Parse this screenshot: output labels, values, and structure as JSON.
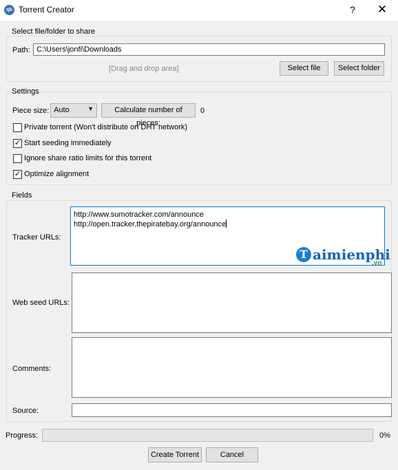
{
  "window": {
    "title": "Torrent Creator",
    "help_label": "?",
    "close_label": "✕"
  },
  "share": {
    "group_title": "Select file/folder to share",
    "path_label": "Path:",
    "path_value": "C:\\Users\\jonfi\\Downloads",
    "drag_drop": "[Drag and drop area]",
    "select_file": "Select file",
    "select_folder": "Select folder"
  },
  "settings": {
    "group_title": "Settings",
    "piece_size_label": "Piece size:",
    "piece_size_value": "Auto",
    "calc_button": "Calculate number of pieces:",
    "pieces_count": "0",
    "options": [
      {
        "label": "Private torrent (Won't distribute on DHT network)",
        "checked": false
      },
      {
        "label": "Start seeding immediately",
        "checked": true
      },
      {
        "label": "Ignore share ratio limits for this torrent",
        "checked": false
      },
      {
        "label": "Optimize alignment",
        "checked": true
      }
    ]
  },
  "fields": {
    "group_title": "Fields",
    "tracker_label": "Tracker URLs:",
    "tracker_lines": [
      "http://www.sumotracker.com/announce",
      "http://open.tracker.thepiratebay.org/announce"
    ],
    "webseed_label": "Web seed URLs:",
    "comments_label": "Comments:",
    "source_label": "Source:",
    "source_value": ""
  },
  "progress": {
    "label": "Progress:",
    "value": 0,
    "text": "0%"
  },
  "actions": {
    "create": "Create Torrent",
    "cancel": "Cancel"
  },
  "watermark": {
    "letter": "T",
    "text": "aimienphi",
    "sub": ".vn"
  },
  "colors": {
    "accent_focus": "#0078d7",
    "watermark_blue": "#1564b4",
    "watermark_green": "#2a9a3d"
  }
}
